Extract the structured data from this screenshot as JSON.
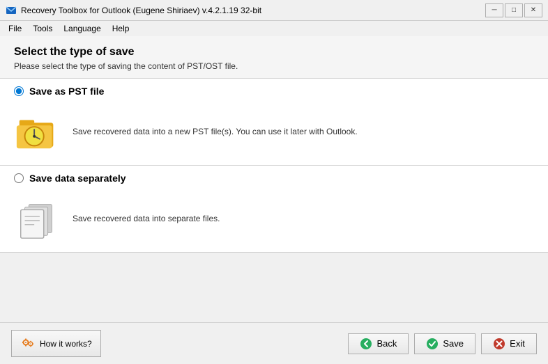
{
  "titleBar": {
    "icon": "📧",
    "title": "Recovery Toolbox for Outlook (Eugene Shiriaev) v.4.2.1.19 32-bit",
    "minimizeLabel": "─",
    "maximizeLabel": "□",
    "closeLabel": "✕"
  },
  "menuBar": {
    "items": [
      {
        "id": "file",
        "label": "File"
      },
      {
        "id": "tools",
        "label": "Tools"
      },
      {
        "id": "language",
        "label": "Language"
      },
      {
        "id": "help",
        "label": "Help"
      }
    ]
  },
  "header": {
    "title": "Select the type of save",
    "subtitle": "Please select the type of saving the content of PST/OST file."
  },
  "options": [
    {
      "id": "save-pst",
      "label": "Save as PST file",
      "description": "Save recovered data into a new PST file(s). You can use it later with Outlook.",
      "checked": true,
      "iconType": "pst"
    },
    {
      "id": "save-separate",
      "label": "Save data separately",
      "description": "Save recovered data into separate files.",
      "checked": false,
      "iconType": "separate"
    }
  ],
  "footer": {
    "howItWorksLabel": "How it works?",
    "backLabel": "Back",
    "saveLabel": "Save",
    "exitLabel": "Exit"
  }
}
